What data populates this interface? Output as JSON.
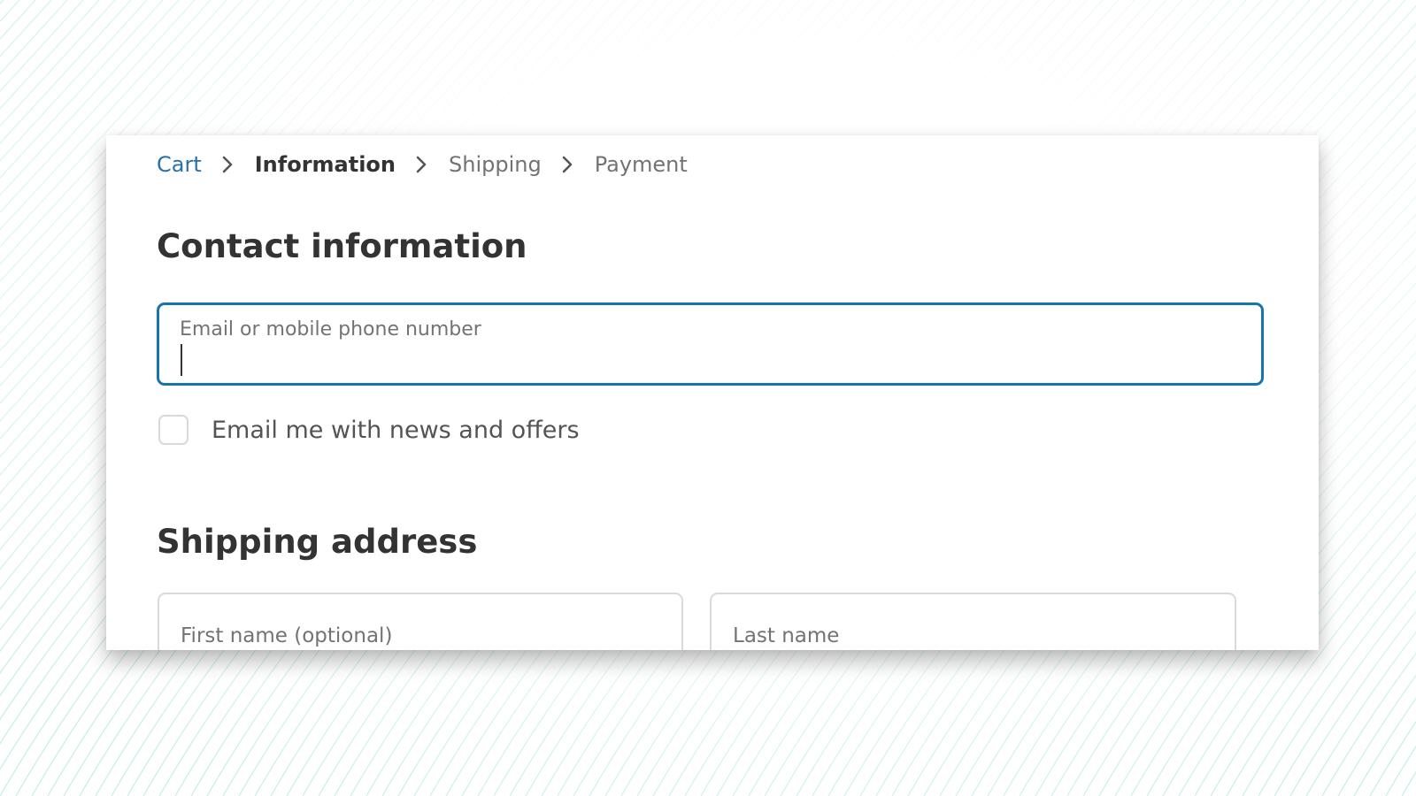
{
  "breadcrumb": {
    "items": [
      {
        "label": "Cart",
        "state": "link"
      },
      {
        "label": "Information",
        "state": "current"
      },
      {
        "label": "Shipping",
        "state": "inactive"
      },
      {
        "label": "Payment",
        "state": "inactive"
      }
    ],
    "separator_icon": "chevron-right-icon"
  },
  "contact": {
    "title": "Contact information",
    "email_field": {
      "label": "Email or mobile phone number",
      "value": "",
      "focused": true
    },
    "newsletter_checkbox": {
      "label": "Email me with news and offers",
      "checked": false
    }
  },
  "shipping": {
    "title": "Shipping address",
    "first_name_field": {
      "label": "First name (optional)",
      "value": ""
    },
    "last_name_field": {
      "label": "Last name",
      "value": ""
    }
  },
  "colors": {
    "accent": "#1773b0",
    "link": "#2a6fa6",
    "text": "#333333",
    "muted": "#737373",
    "border": "#d9d9d9",
    "background_pattern": "#b2e8da"
  }
}
